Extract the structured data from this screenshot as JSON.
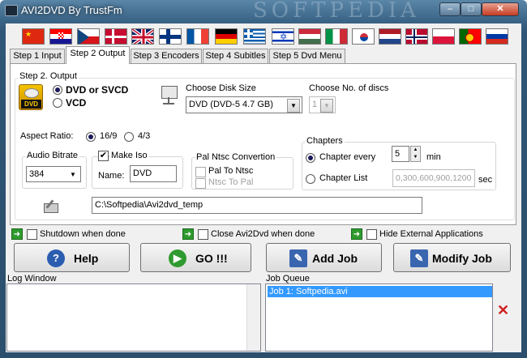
{
  "window": {
    "title": "AVI2DVD By TrustFm",
    "watermark": "SOFTPEDIA",
    "controls": {
      "minimize": "–",
      "maximize": "□",
      "close": "✕"
    }
  },
  "flags": [
    "China",
    "Croatia",
    "Czech Republic",
    "Denmark",
    "United Kingdom",
    "Finland",
    "France",
    "Germany",
    "Greece",
    "Israel",
    "Hungary",
    "Italy",
    "South Korea",
    "Netherlands",
    "Norway",
    "Poland",
    "Portugal",
    "Russia"
  ],
  "tabs": [
    "Step 1 Input",
    "Step 2 Output",
    "Step 3 Encoders",
    "Step 4 Subitles",
    "Step 5 Dvd Menu"
  ],
  "active_tab": "Step 2 Output",
  "output": {
    "group_label": "Step 2. Output",
    "dvd_option": "DVD or SVCD",
    "vcd_option": "VCD",
    "dvd_icon_text": "DVD",
    "selected": "DVD or SVCD",
    "disk_size_label": "Choose Disk Size",
    "disk_size_value": "DVD (DVD-5 4.7 GB)",
    "discs_label": "Choose No. of discs",
    "discs_value": "1"
  },
  "aspect": {
    "label": "Aspect Ratio:",
    "opt1": "16/9",
    "opt2": "4/3",
    "selected": "16/9"
  },
  "audio": {
    "label": "Audio Bitrate",
    "value": "384"
  },
  "iso": {
    "label": "Make Iso",
    "checked": true,
    "name_label": "Name:",
    "name_value": "DVD"
  },
  "pal_ntsc": {
    "label": "Pal Ntsc Convertion",
    "pal_to_ntsc": "Pal To Ntsc",
    "ntsc_to_pal": "Ntsc To Pal"
  },
  "chapters": {
    "label": "Chapters",
    "every_label": "Chapter every",
    "every_value": "5",
    "unit": "min",
    "list_label": "Chapter List",
    "list_value": "0,300,600,900,1200",
    "list_unit": "sec"
  },
  "temp_path": "C:\\Softpedia\\Avi2dvd_temp",
  "options": {
    "shutdown": "Shutdown when done",
    "close": "Close Avi2Dvd when done",
    "hide": "Hide External Applications"
  },
  "buttons": {
    "help": "Help",
    "go": "GO !!!",
    "add_job": "Add Job",
    "modify_job": "Modify Job"
  },
  "log_window": {
    "label": "Log Window"
  },
  "job_queue": {
    "label": "Job Queue",
    "items": [
      "Job 1: Softpedia.avi"
    ]
  },
  "colors": {
    "title_bar": "#3a6486",
    "selection": "#3399ff",
    "delete_icon": "#d02020"
  }
}
